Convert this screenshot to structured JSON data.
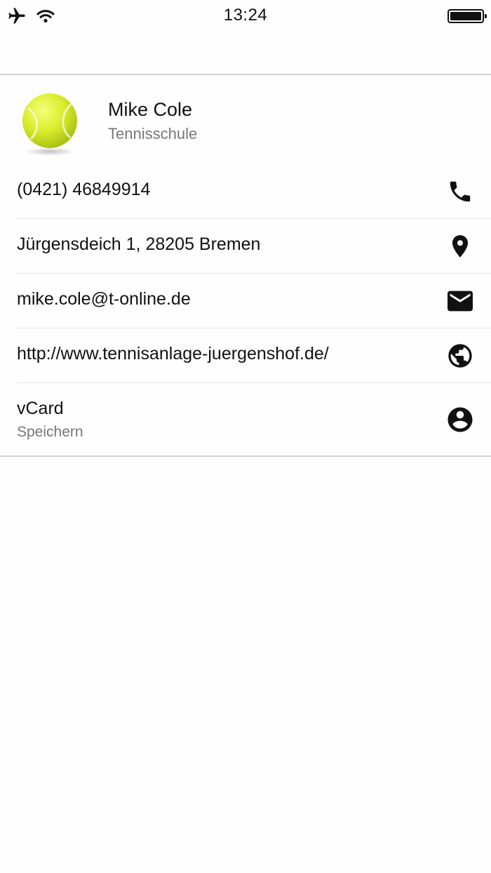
{
  "status_bar": {
    "time": "13:24",
    "icons": [
      "airplane-icon",
      "wifi-icon",
      "battery-icon"
    ]
  },
  "contact": {
    "name": "Mike Cole",
    "subtitle": "Tennisschule",
    "avatar": "tennis-ball-image"
  },
  "rows": [
    {
      "text": "(0421) 46849914",
      "icon": "phone-icon"
    },
    {
      "text": "Jürgensdeich 1, 28205 Bremen",
      "icon": "map-pin-icon"
    },
    {
      "text": "mike.cole@t-online.de",
      "icon": "mail-icon"
    },
    {
      "text": "http://www.tennisanlage-juergenshof.de/",
      "icon": "globe-icon"
    },
    {
      "text": "vCard",
      "subtext": "Speichern",
      "icon": "account-circle-icon"
    }
  ],
  "colors": {
    "text_primary": "#111111",
    "text_secondary": "#777777",
    "divider": "#d2d2d2",
    "background": "#fefefe"
  }
}
